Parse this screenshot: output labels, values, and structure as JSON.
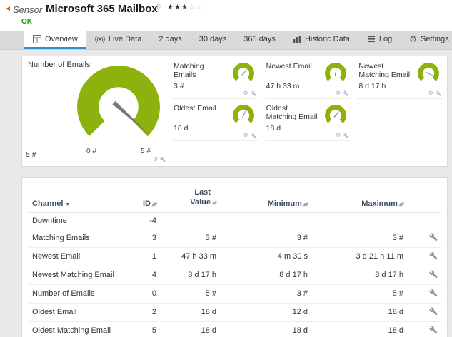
{
  "header": {
    "kind": "Sensor",
    "title": "Microsoft 365 Mailbox",
    "status": "OK",
    "stars_filled": "★★★",
    "stars_empty": "☆☆"
  },
  "tabs": [
    "Overview",
    "Live Data",
    "2 days",
    "30 days",
    "365 days",
    "Historic Data",
    "Log",
    "Settings"
  ],
  "icons": {
    "back": "◄",
    "flag": "⚐",
    "gear": "⚙",
    "sort": "▴▾",
    "sort_desc": "▼"
  },
  "gauges": {
    "main": {
      "title": "Number of Emails",
      "value": "5 #",
      "scale_min": "0 #",
      "scale_max": "5 #",
      "needle_angle": 132
    },
    "small": [
      {
        "title": "Matching Emails",
        "value": "3 #",
        "needle_angle": 40
      },
      {
        "title": "Newest Email",
        "value": "47 h 33 m",
        "needle_angle": 8
      },
      {
        "title": "Newest Matching Email",
        "value": "8 d 17 h",
        "needle_angle": 115
      },
      {
        "title": "Oldest Email",
        "value": "18 d",
        "needle_angle": 25
      },
      {
        "title": "Oldest Matching Email",
        "value": "18 d",
        "needle_angle": 42
      }
    ]
  },
  "table": {
    "columns": [
      "Channel",
      "ID",
      "Last Value",
      "Minimum",
      "Maximum"
    ],
    "rows": [
      {
        "channel": "Downtime",
        "id": "-4",
        "last": "",
        "min": "",
        "max": ""
      },
      {
        "channel": "Matching Emails",
        "id": "3",
        "last": "3 #",
        "min": "3 #",
        "max": "3 #"
      },
      {
        "channel": "Newest Email",
        "id": "1",
        "last": "47 h 33 m",
        "min": "4 m 30 s",
        "max": "3 d 21 h 11 m"
      },
      {
        "channel": "Newest Matching Email",
        "id": "4",
        "last": "8 d 17 h",
        "min": "8 d 17 h",
        "max": "8 d 17 h"
      },
      {
        "channel": "Number of Emails",
        "id": "0",
        "last": "5 #",
        "min": "3 #",
        "max": "5 #"
      },
      {
        "channel": "Oldest Email",
        "id": "2",
        "last": "18 d",
        "min": "12 d",
        "max": "18 d"
      },
      {
        "channel": "Oldest Matching Email",
        "id": "5",
        "last": "18 d",
        "min": "18 d",
        "max": "18 d"
      }
    ]
  },
  "colors": {
    "accent_green": "#8EB20D",
    "status_ok": "#0AA10A",
    "tab_underline": "#2F8FD6",
    "brand_orange": "#E25A00"
  }
}
